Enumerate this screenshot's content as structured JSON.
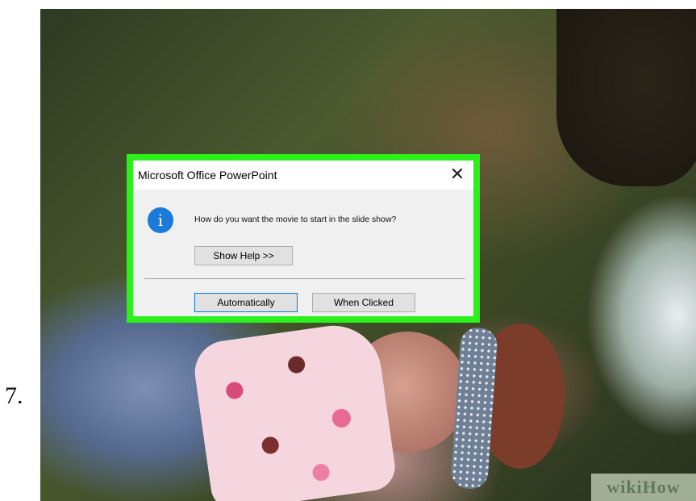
{
  "step": {
    "number": "7."
  },
  "photo": {
    "watermark": "wikiHow"
  },
  "dialog": {
    "title": "Microsoft Office PowerPoint",
    "close_glyph": "✕",
    "icon": "info-icon",
    "icon_glyph": "i",
    "message": "How do you want the movie to start in the slide show?",
    "help_button": "Show Help >>",
    "buttons": {
      "automatically": "Automatically",
      "when_clicked": "When Clicked"
    },
    "highlight_color": "#2bf01c"
  }
}
